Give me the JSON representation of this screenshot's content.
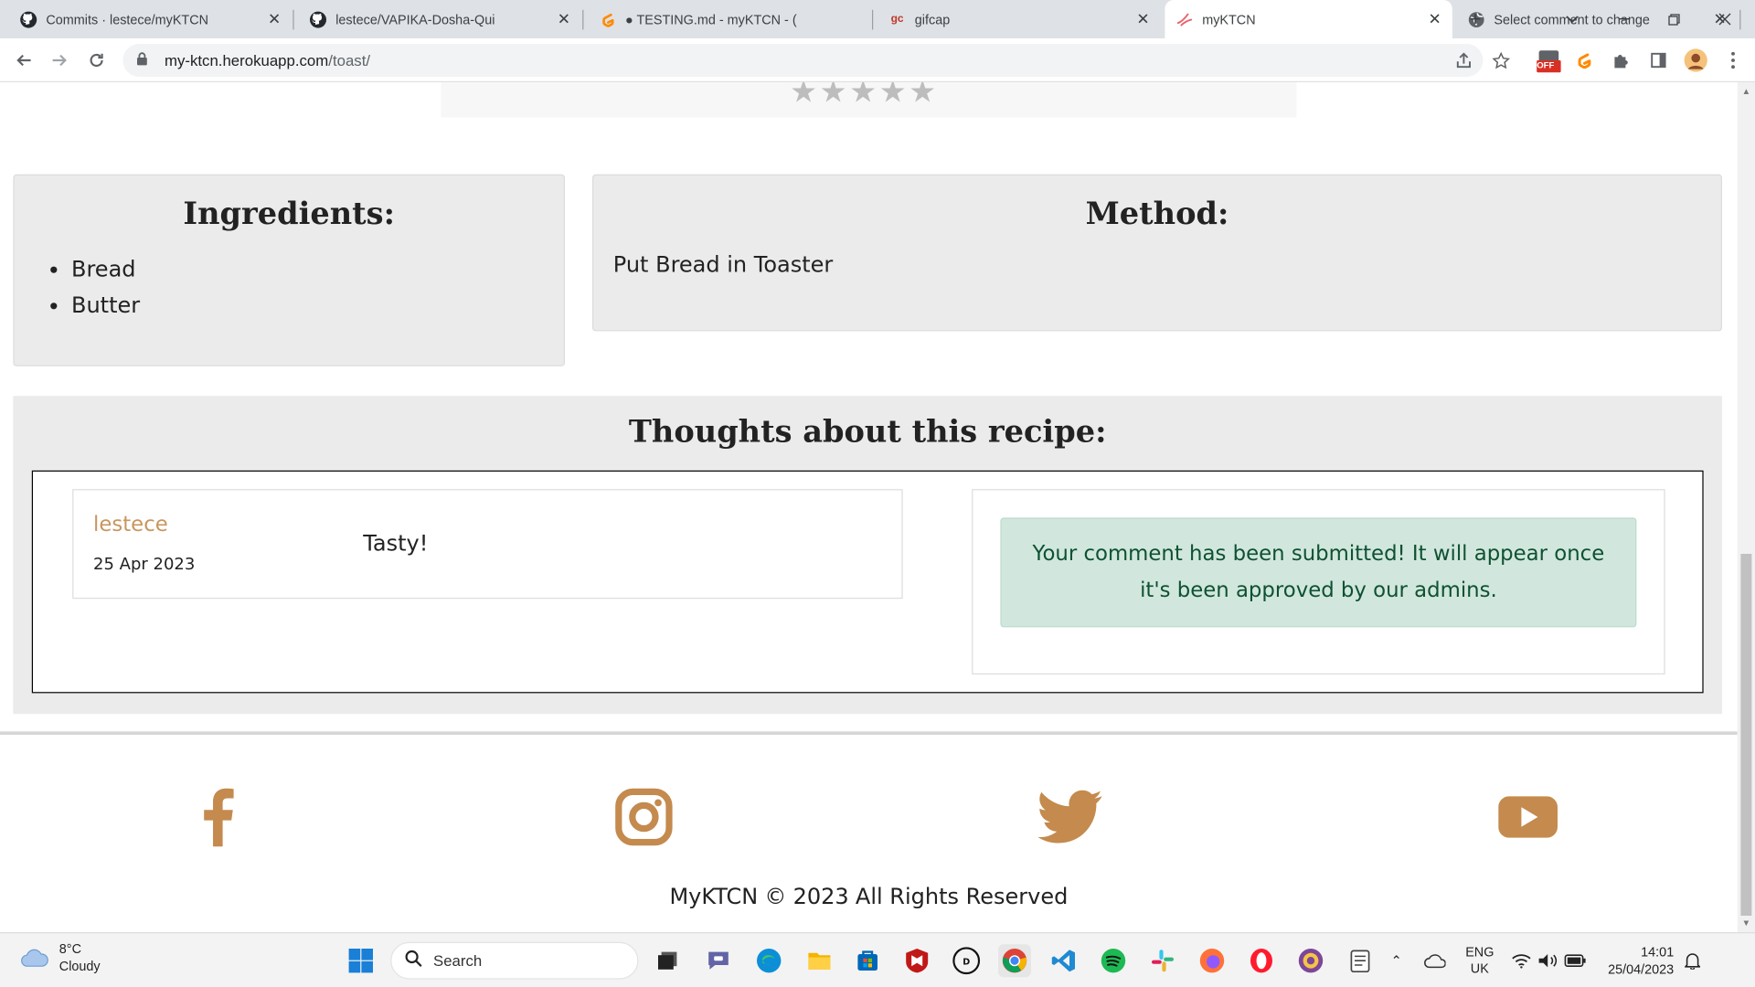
{
  "browser": {
    "tabs": [
      {
        "title": "Commits · lestece/myKTCN",
        "icon": "github-icon"
      },
      {
        "title": "lestece/VAPIKA-Dosha-Qui",
        "icon": "github-icon"
      },
      {
        "title": "● TESTING.md - myKTCN - (",
        "icon": "gitpod-icon"
      },
      {
        "title": "gifcap",
        "icon": "gifcap-icon",
        "icon_text": "gc"
      },
      {
        "title": "myKTCN",
        "icon": "myktcn-icon",
        "active": true
      },
      {
        "title": "Select comment to change",
        "icon": "globe-icon"
      }
    ],
    "new_tab_label": "+",
    "url_host": "my-ktcn.herokuapp.com",
    "url_path": "/toast/",
    "extension_badge": "OFF"
  },
  "recipe": {
    "rating_stars": 5,
    "ingredients_title": "Ingredients:",
    "ingredients": [
      "Bread",
      "Butter"
    ],
    "method_title": "Method:",
    "method_text": "Put Bread in Toaster"
  },
  "comments": {
    "title": "Thoughts about this recipe:",
    "items": [
      {
        "author": "lestece",
        "date": "25 Apr 2023",
        "body": "Tasty!"
      }
    ],
    "success_message": "Your comment has been submitted! It will appear once it's been approved by our admins."
  },
  "footer": {
    "social": [
      "facebook-icon",
      "instagram-icon",
      "twitter-icon",
      "youtube-icon"
    ],
    "brand": "MyKTCN",
    "copyright_symbol": "©",
    "year": "2023",
    "rights": "All Rights Reserved",
    "brand_color": "#c48a4e"
  },
  "taskbar": {
    "temperature": "8°C",
    "condition": "Cloudy",
    "search_placeholder": "Search",
    "language_top": "ENG",
    "language_bottom": "UK",
    "time": "14:01",
    "date": "25/04/2023"
  }
}
